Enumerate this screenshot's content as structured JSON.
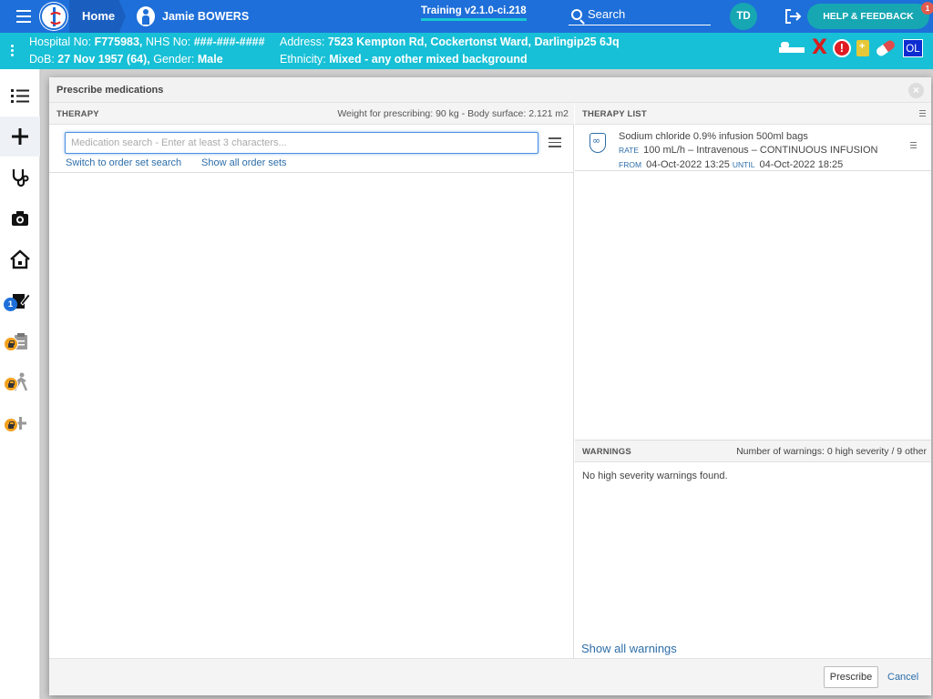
{
  "topbar": {
    "home_label": "Home",
    "patient_name": "Jamie BOWERS",
    "environment": "Training v2.1.0-ci.218",
    "search_label": "Search",
    "user_initials": "TD",
    "help_label": "HELP & FEEDBACK",
    "help_badge_count": "1"
  },
  "banner": {
    "hospital_label": "Hospital No:",
    "hospital_no": "F775983,",
    "nhs_label": "NHS No:",
    "nhs_no": "###-###-####",
    "dob_label": "DoB:",
    "dob": "27 Nov 1957 (64),",
    "gender_label": "Gender:",
    "gender": "Male",
    "address_label": "Address:",
    "address": "7523 Kempton Rd, Cockertonst Ward, Darlingip25 6Jq",
    "ethnicity_label": "Ethnicity:",
    "ethnicity": "Mixed - any other mixed background",
    "alert_x": "X",
    "alert_exclaim": "!",
    "ol_badge": "OL"
  },
  "leftnav": {
    "items": [
      {
        "name": "list-icon"
      },
      {
        "name": "add-icon"
      },
      {
        "name": "stethoscope-icon"
      },
      {
        "name": "camera-icon"
      },
      {
        "name": "home-icon"
      },
      {
        "name": "edit-document-icon",
        "badge": "1"
      },
      {
        "name": "clipboard-icon",
        "locked": true
      },
      {
        "name": "walking-icon",
        "locked": true
      },
      {
        "name": "plus-icon",
        "locked": true
      }
    ]
  },
  "modal": {
    "title": "Prescribe medications",
    "therapy_header": "THERAPY",
    "weight_info": "Weight for prescribing: 90 kg - Body surface: 2.121 m2",
    "search_placeholder": "Medication search - Enter at least 3 characters...",
    "search_value": "",
    "switch_link": "Switch to order set search",
    "show_all_sets_link": "Show all order sets",
    "therapy_list_header": "THERAPY LIST",
    "therapy_item": {
      "name": "Sodium chloride 0.9% infusion 500ml bags",
      "rate_kw": "RATE",
      "rate": "100 mL/h – Intravenous – CONTINUOUS INFUSION",
      "from_kw": "FROM",
      "from": "04-Oct-2022 13:25",
      "until_kw": "UNTIL",
      "until": "04-Oct-2022 18:25"
    },
    "warnings_header": "WARNINGS",
    "warnings_count": "Number of warnings: 0 high severity / 9 other",
    "warnings_text": "No high severity warnings found.",
    "show_all_warnings": "Show all warnings",
    "prescribe_label": "Prescribe",
    "cancel_label": "Cancel"
  },
  "colors": {
    "topbar": "#1e6fd9",
    "banner": "#17c0d6",
    "accent_teal": "#16a7b3",
    "link": "#2d6ea8",
    "lock_badge": "#f2a11f"
  }
}
